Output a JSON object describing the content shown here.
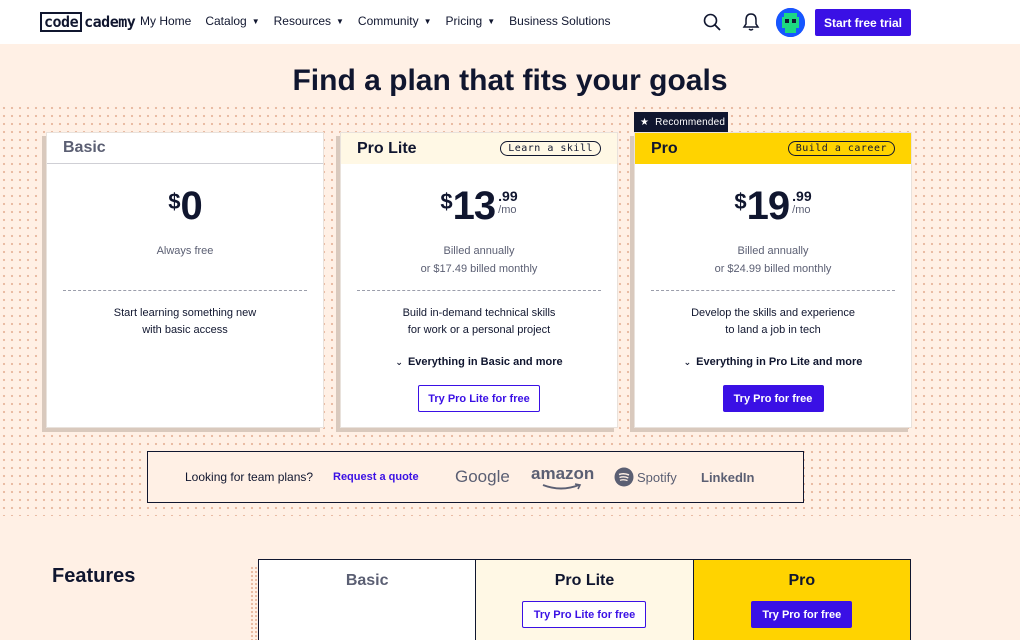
{
  "nav": {
    "logo_boxed": "code",
    "logo_rest": "cademy",
    "links": [
      {
        "label": "My Home",
        "caret": false
      },
      {
        "label": "Catalog",
        "caret": true
      },
      {
        "label": "Resources",
        "caret": true
      },
      {
        "label": "Community",
        "caret": true
      },
      {
        "label": "Pricing",
        "caret": true
      },
      {
        "label": "Business Solutions",
        "caret": false
      }
    ],
    "icons": [
      "search-icon",
      "bell-icon"
    ],
    "cta": "Start free trial"
  },
  "headline": "Find a plan that fits your goals",
  "plans": {
    "basic": {
      "name": "Basic",
      "currency": "$",
      "amount": "0",
      "billing_line1": "Always free",
      "desc_line1": "Start learning something new",
      "desc_line2": "with basic access"
    },
    "lite": {
      "name": "Pro Lite",
      "tag": "Learn a skill",
      "currency": "$",
      "amount": "13",
      "cents": ".99",
      "per": "/mo",
      "billing_line1": "Billed annually",
      "billing_line2": "or $17.49 billed monthly",
      "desc_line1": "Build in-demand technical skills",
      "desc_line2": "for work or a personal project",
      "more": "Everything in Basic and more",
      "button": "Try Pro Lite for free"
    },
    "pro": {
      "badge": "Recommended",
      "name": "Pro",
      "tag": "Build a career",
      "currency": "$",
      "amount": "19",
      "cents": ".99",
      "per": "/mo",
      "billing_line1": "Billed annually",
      "billing_line2": "or $24.99 billed monthly",
      "desc_line1": "Develop the skills and experience",
      "desc_line2": "to land a job in tech",
      "more": "Everything in Pro Lite and more",
      "button": "Try Pro for free"
    }
  },
  "team": {
    "question": "Looking for team plans?",
    "link": "Request a quote",
    "brands": [
      "Google",
      "amazon",
      "Spotify",
      "LinkedIn"
    ]
  },
  "features": {
    "title": "Features",
    "columns": [
      {
        "name": "Basic"
      },
      {
        "name": "Pro Lite",
        "button": "Try Pro Lite for free"
      },
      {
        "name": "Pro",
        "button": "Try Pro for free"
      }
    ]
  },
  "colors": {
    "accent": "#3a10e5",
    "navy": "#10162f",
    "page_bg": "#fff0e5",
    "pro_yellow": "#ffd300",
    "lite_cream": "#fff8e5"
  }
}
